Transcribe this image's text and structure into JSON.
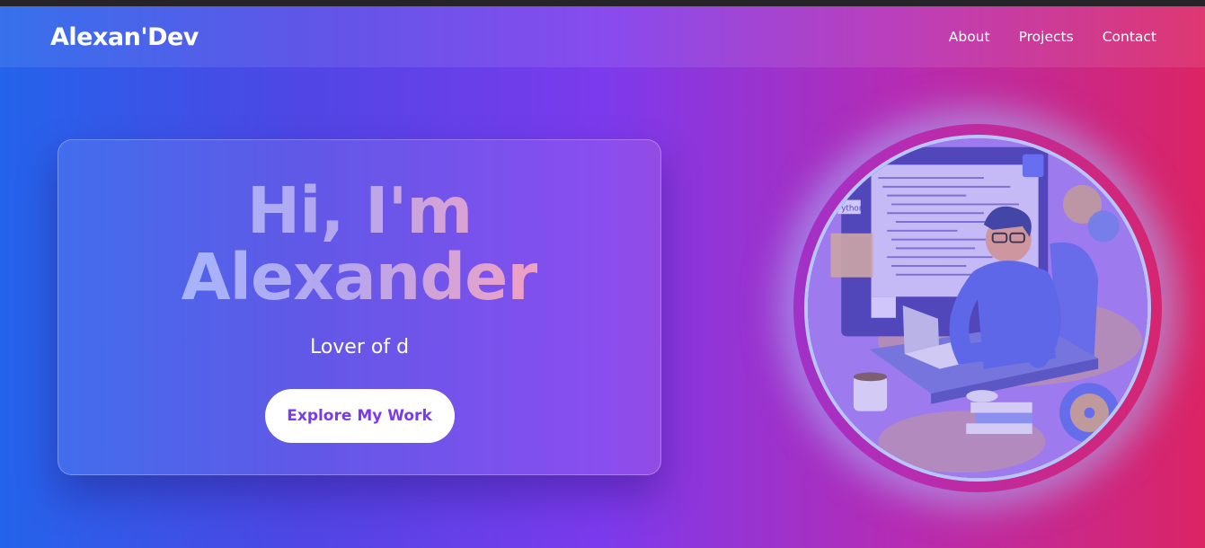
{
  "nav": {
    "brand": "Alexan'Dev",
    "links": [
      "About",
      "Projects",
      "Contact"
    ]
  },
  "hero": {
    "title_line1": "Hi, I'm",
    "title_line2": "Alexander",
    "subtitle": "Lover of d",
    "cta_label": "Explore My Work"
  },
  "illustration": {
    "python_tag": "ython",
    "icon": "developer-at-desk-illustration"
  },
  "colors": {
    "gradient_start": "#2463eb",
    "gradient_mid": "#7c3aed",
    "gradient_end": "#db2464",
    "cta_text": "#7c3aed"
  }
}
